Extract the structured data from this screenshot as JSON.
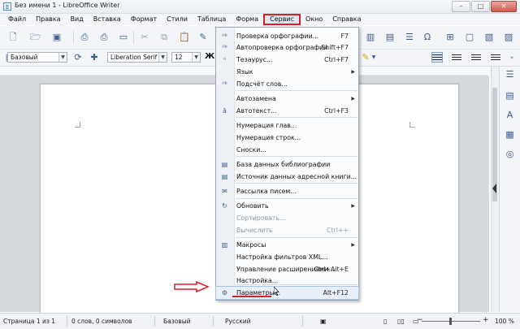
{
  "window": {
    "title": "Без имени 1 - LibreOffice Writer",
    "buttons": {
      "minimize": "–",
      "maximize": "□",
      "close": "✕"
    }
  },
  "menubar": {
    "items": [
      "Файл",
      "Правка",
      "Вид",
      "Вставка",
      "Формат",
      "Стили",
      "Таблица",
      "Форма",
      "Сервис",
      "Окно",
      "Справка"
    ],
    "active": "Сервис"
  },
  "formatting": {
    "style": "Базовый",
    "font": "Liberation Serif",
    "size": "12",
    "bold_glyph": "Ж"
  },
  "tools_menu": {
    "items": [
      {
        "label": "Проверка орфографии...",
        "shortcut": "F7",
        "icon": "spellcheck-icon",
        "icon_glyph": "ᴬᵇ"
      },
      {
        "label": "Автопроверка орфографии",
        "shortcut": "Shift+F7",
        "icon": "autospellcheck-icon",
        "icon_glyph": "ᴬᵇ"
      },
      {
        "label": "Тезаурус...",
        "shortcut": "Ctrl+F7",
        "icon": "thesaurus-icon",
        "icon_glyph": "ᴬ"
      },
      {
        "label": "Язык",
        "submenu": true
      },
      {
        "label": "Подсчёт слов...",
        "icon": "word-count-icon",
        "icon_glyph": "ᴬᵇ"
      },
      {
        "label": "Автозамена",
        "submenu": true
      },
      {
        "label": "Автотекст...",
        "shortcut": "Ctrl+F3",
        "icon": "autotext-icon",
        "icon_glyph": "ā"
      },
      {
        "label": "Нумерация глав..."
      },
      {
        "label": "Нумерация строк..."
      },
      {
        "label": "Сноски..."
      },
      {
        "label": "База данных библиографии",
        "icon": "bibliography-icon",
        "icon_glyph": "▤"
      },
      {
        "label": "Источник данных адресной книги...",
        "icon": "address-book-icon",
        "icon_glyph": "▤"
      },
      {
        "label": "Рассылка писем...",
        "icon": "mail-merge-icon",
        "icon_glyph": "✉"
      },
      {
        "label": "Обновить",
        "submenu": true,
        "icon": "refresh-icon",
        "icon_glyph": "↻"
      },
      {
        "label": "Сортировать...",
        "disabled": true
      },
      {
        "label": "Вычислить",
        "shortcut": "Ctrl++",
        "disabled": true
      },
      {
        "label": "Макросы",
        "submenu": true,
        "icon": "macros-icon",
        "icon_glyph": "▥"
      },
      {
        "label": "Настройка фильтров XML..."
      },
      {
        "label": "Управление расширениями...",
        "shortcut": "Ctrl+Alt+E"
      },
      {
        "label": "Настройка..."
      },
      {
        "label": "Параметры...",
        "shortcut": "Alt+F12",
        "icon": "options-gear-icon",
        "icon_glyph": "⚙",
        "highlighted": true
      }
    ]
  },
  "statusbar": {
    "page": "Страница 1 из 1",
    "words": "0 слов, 0 символов",
    "style": "Базовый",
    "language": "Русский",
    "zoom": "100 %",
    "zoom_level": 1.0
  },
  "colors": {
    "highlight_red": "#d91f26",
    "accent_blue": "#3b5d8c"
  }
}
